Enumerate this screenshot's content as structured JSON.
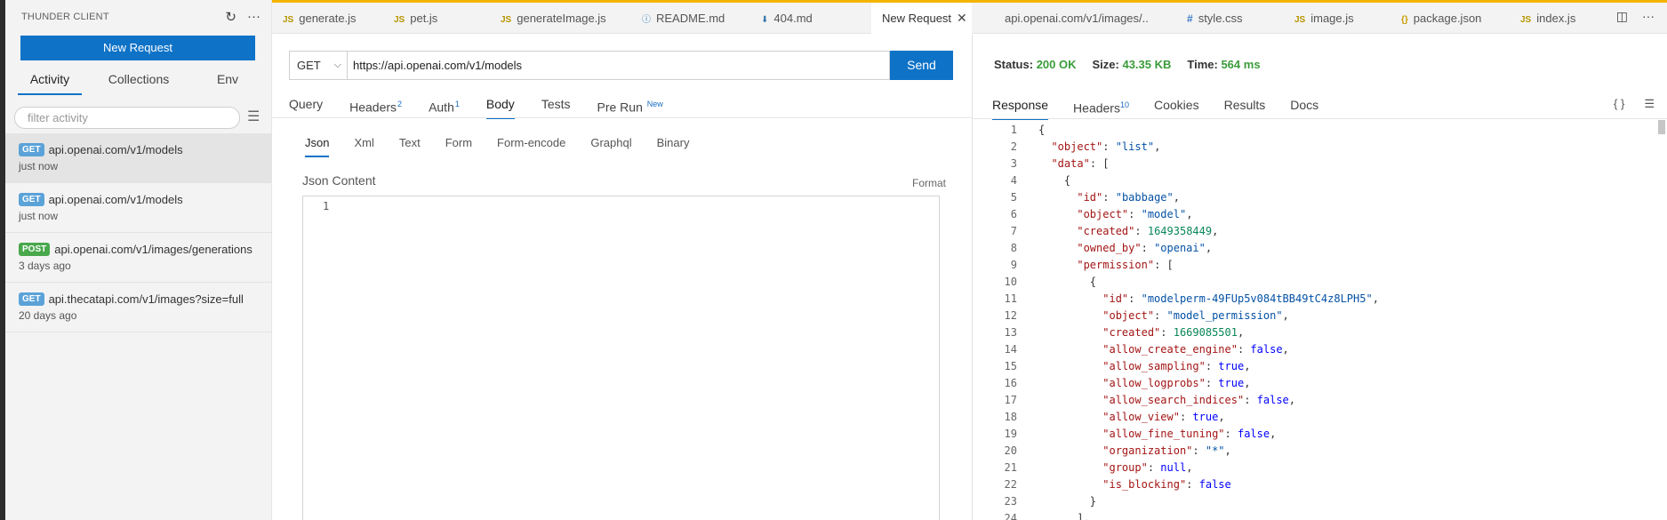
{
  "sidebar": {
    "title": "THUNDER CLIENT",
    "refresh_icon": "↻",
    "more_icon": "···",
    "new_request": "New Request",
    "tabs": [
      "Activity",
      "Collections",
      "Env"
    ],
    "filter_placeholder": "filter activity",
    "activity": [
      {
        "method": "GET",
        "url": "api.openai.com/v1/models",
        "time": "just now"
      },
      {
        "method": "GET",
        "url": "api.openai.com/v1/models",
        "time": "just now"
      },
      {
        "method": "POST",
        "url": "api.openai.com/v1/images/generations",
        "time": "3 days ago"
      },
      {
        "method": "GET",
        "url": "api.thecatapi.com/v1/images?size=full",
        "time": "20 days ago"
      }
    ]
  },
  "tabs": [
    {
      "label": "generate.js",
      "icon": "JS"
    },
    {
      "label": "pet.js",
      "icon": "JS"
    },
    {
      "label": "generateImage.js",
      "icon": "JS"
    },
    {
      "label": "README.md",
      "icon": "ⓘ"
    },
    {
      "label": "404.md",
      "icon": "⬇"
    },
    {
      "label": "New Request",
      "close": "✕"
    },
    {
      "label": "api.openai.com/v1/images/.."
    },
    {
      "label": "style.css",
      "icon": "#"
    },
    {
      "label": "image.js",
      "icon": "JS"
    },
    {
      "label": "package.json",
      "icon": "{}"
    },
    {
      "label": "index.js",
      "icon": "JS"
    }
  ],
  "request": {
    "method": "GET",
    "method_chevron": "⌵",
    "url": "https://api.openai.com/v1/models",
    "send": "Send",
    "tabs": {
      "query": "Query",
      "headers": "Headers",
      "headers_count": "2",
      "auth": "Auth",
      "auth_count": "1",
      "body": "Body",
      "tests": "Tests",
      "prerun": "Pre Run",
      "prerun_badge": "New"
    },
    "body_tabs": [
      "Json",
      "Xml",
      "Text",
      "Form",
      "Form-encode",
      "Graphql",
      "Binary"
    ],
    "json_label": "Json Content",
    "format": "Format",
    "editor_line": "1"
  },
  "response": {
    "status_label": "Status:",
    "status_value": "200 OK",
    "size_label": "Size:",
    "size_value": "43.35 KB",
    "time_label": "Time:",
    "time_value": "564 ms",
    "tabs": {
      "response": "Response",
      "headers": "Headers",
      "headers_count": "10",
      "cookies": "Cookies",
      "results": "Results",
      "docs": "Docs"
    },
    "tools": {
      "braces": "{ }",
      "menu": "☰"
    },
    "lines": [
      "{",
      "  \"object\": \"list\",",
      "  \"data\": [",
      "    {",
      "      \"id\": \"babbage\",",
      "      \"object\": \"model\",",
      "      \"created\": 1649358449,",
      "      \"owned_by\": \"openai\",",
      "      \"permission\": [",
      "        {",
      "          \"id\": \"modelperm-49FUp5v084tBB49tC4z8LPH5\",",
      "          \"object\": \"model_permission\",",
      "          \"created\": 1669085501,",
      "          \"allow_create_engine\": false,",
      "          \"allow_sampling\": true,",
      "          \"allow_logprobs\": true,",
      "          \"allow_search_indices\": false,",
      "          \"allow_view\": true,",
      "          \"allow_fine_tuning\": false,",
      "          \"organization\": \"*\",",
      "          \"group\": null,",
      "          \"is_blocking\": false",
      "        }",
      "      ],"
    ]
  },
  "colors": {
    "accent": "#0e72c7",
    "status_ok": "#3a9b3a",
    "get_badge": "#5ba2d8",
    "post_badge": "#49a84c",
    "json_key": "#a31515",
    "json_string": "#0451a5",
    "json_number": "#098658",
    "json_literal": "#0000ff"
  }
}
